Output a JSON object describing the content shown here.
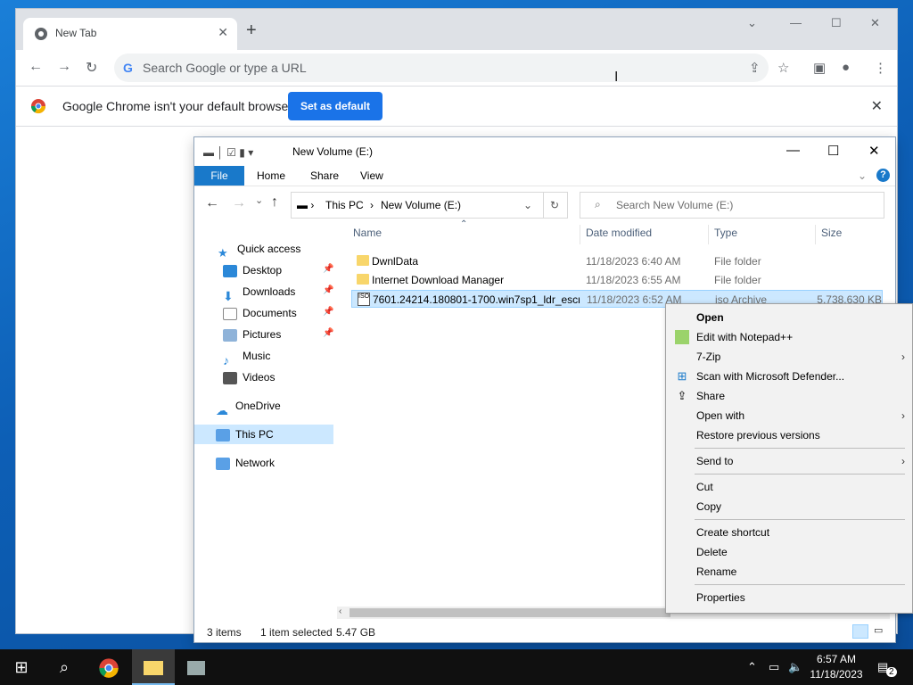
{
  "chrome": {
    "tab_title": "New Tab",
    "tab_close": "✕",
    "new_tab": "+",
    "omnibox_placeholder": "Search Google or type a URL",
    "infobar_message": "Google Chrome isn't your default browser",
    "set_default_label": "Set as default",
    "infobar_close": "✕"
  },
  "explorer": {
    "title": "New Volume (E:)",
    "ribbon_tabs": [
      "File",
      "Home",
      "Share",
      "View"
    ],
    "address": [
      "This PC",
      "New Volume (E:)"
    ],
    "search_placeholder": "Search New Volume (E:)",
    "nav": {
      "quick_access": "Quick access",
      "desktop": "Desktop",
      "downloads": "Downloads",
      "documents": "Documents",
      "pictures": "Pictures",
      "music": "Music",
      "videos": "Videos",
      "onedrive": "OneDrive",
      "this_pc": "This PC",
      "network": "Network"
    },
    "columns": [
      "Name",
      "Date modified",
      "Type",
      "Size"
    ],
    "files": [
      {
        "name": "DwnlData",
        "date": "11/18/2023 6:40 AM",
        "type": "File folder",
        "size": ""
      },
      {
        "name": "Internet Download Manager",
        "date": "11/18/2023 6:55 AM",
        "type": "File folder",
        "size": ""
      },
      {
        "name": "7601.24214.180801-1700.win7sp1_ldr_escr...",
        "date": "11/18/2023 6:52 AM",
        "type": "iso Archive",
        "size": "5,738,630 KB"
      }
    ],
    "status": {
      "items": "3 items",
      "selected": "1 item selected",
      "size": "5.47 GB"
    }
  },
  "context_menu": {
    "open": "Open",
    "edit_notepad": "Edit with Notepad++",
    "seven_zip": "7-Zip",
    "scan_defender": "Scan with Microsoft Defender...",
    "share": "Share",
    "open_with": "Open with",
    "restore": "Restore previous versions",
    "send_to": "Send to",
    "cut": "Cut",
    "copy": "Copy",
    "create_shortcut": "Create shortcut",
    "delete": "Delete",
    "rename": "Rename",
    "properties": "Properties"
  },
  "taskbar": {
    "time": "6:57 AM",
    "date": "11/18/2023",
    "notifications": "2"
  },
  "colors": {
    "accent": "#1a73e8",
    "explorer_file_tab": "#1979ca",
    "selection": "#cce8ff"
  }
}
